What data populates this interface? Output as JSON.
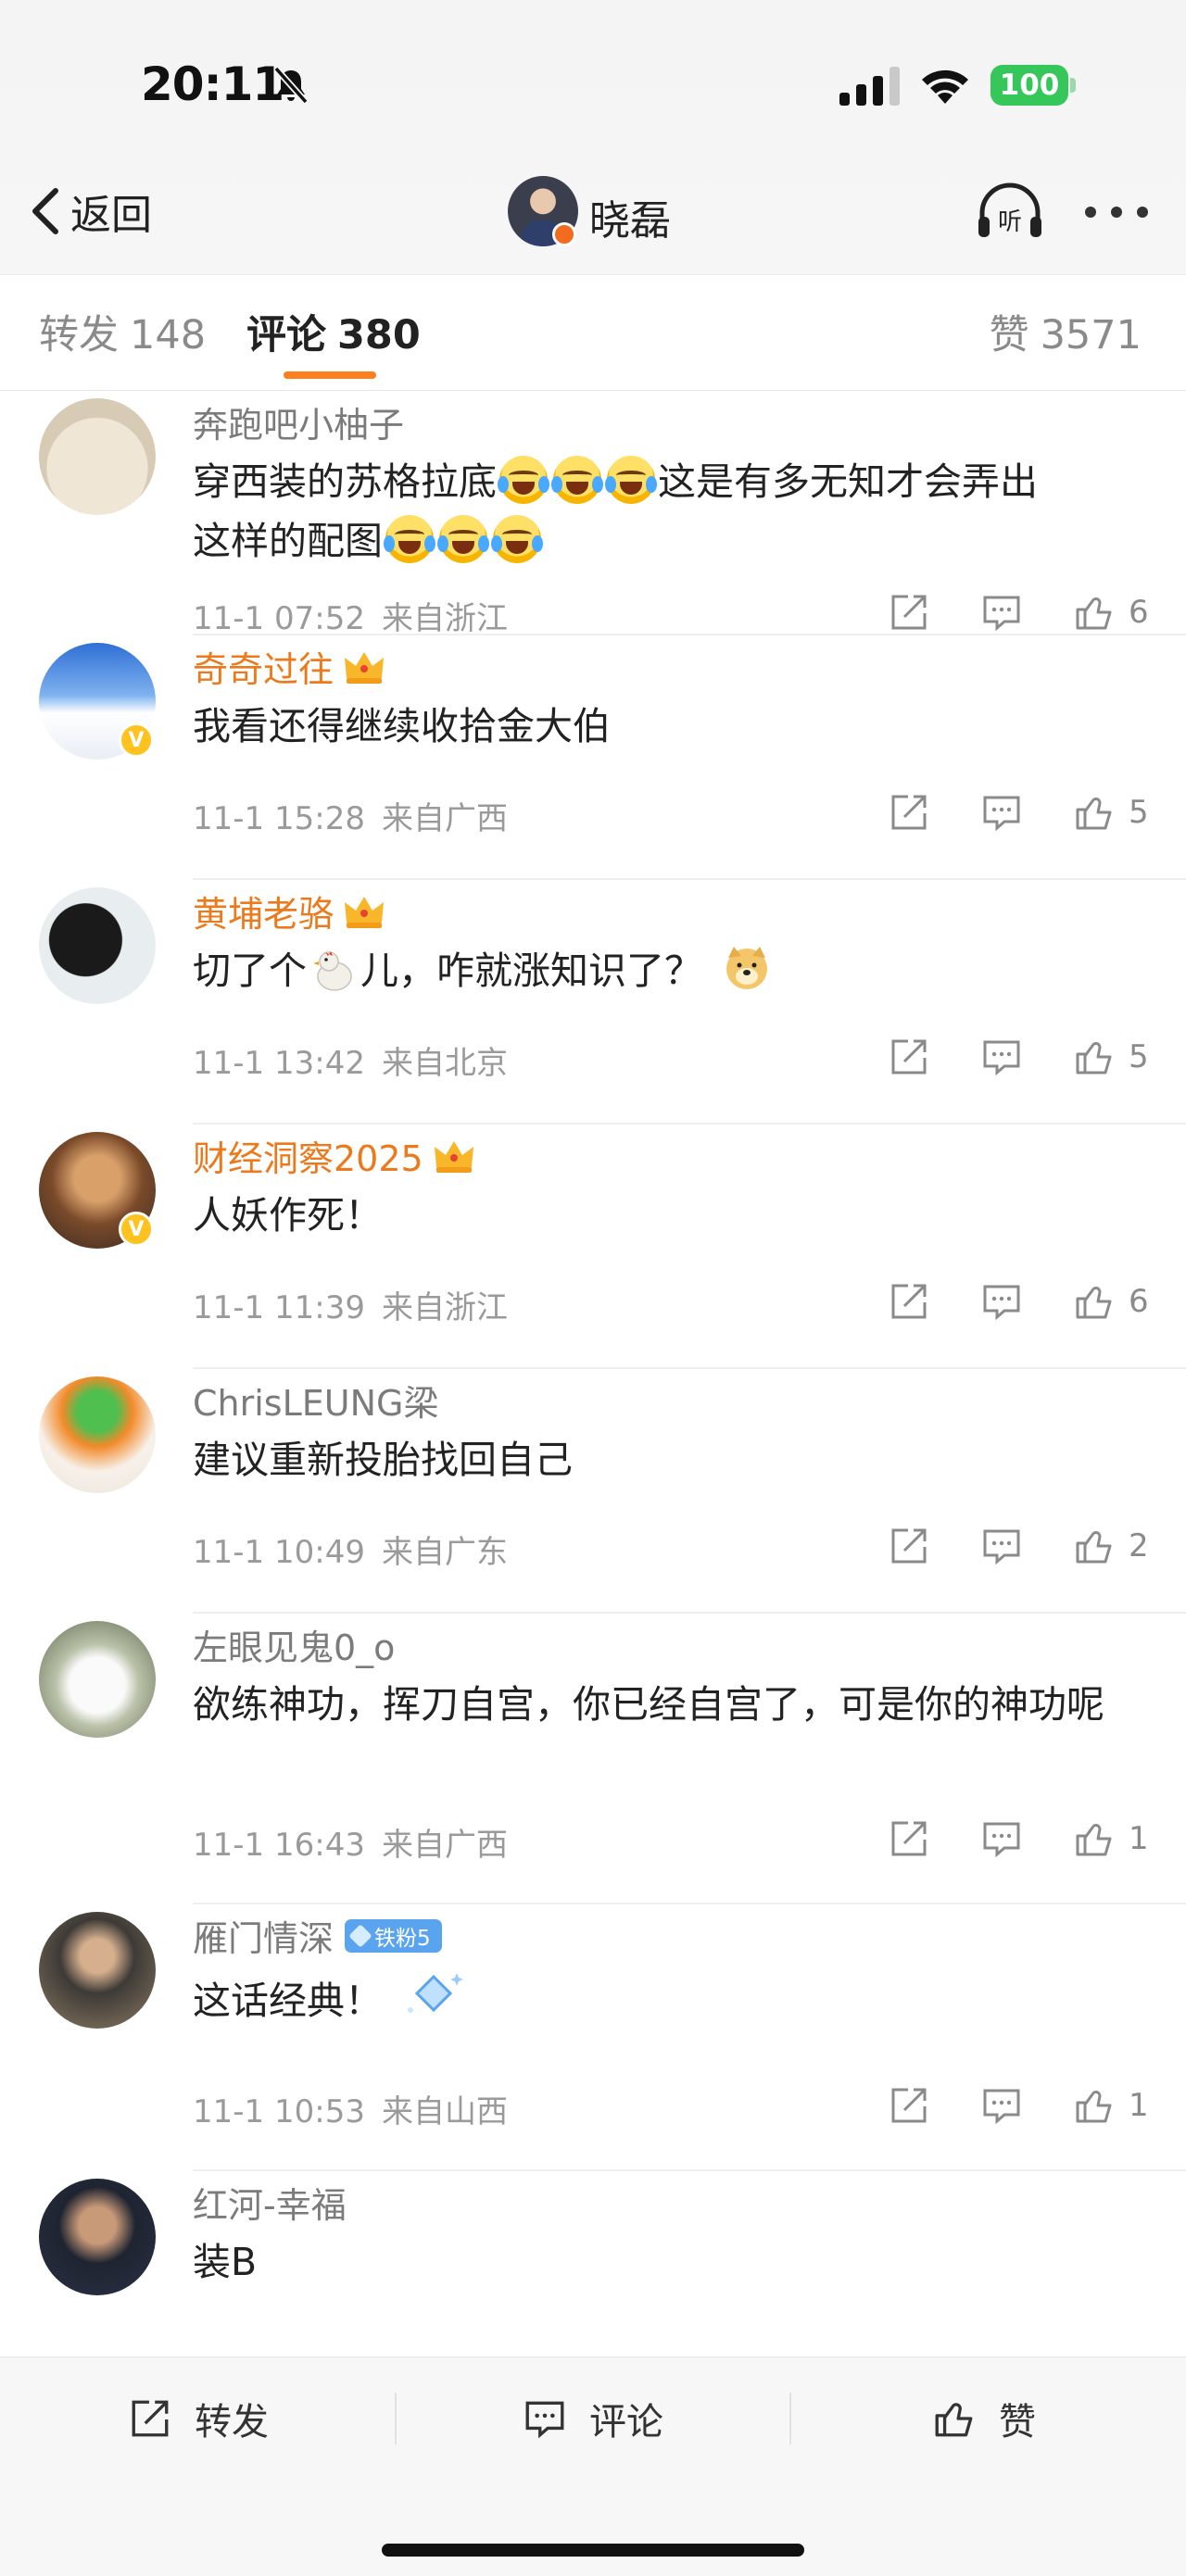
{
  "status": {
    "time": "20:11",
    "battery": "100"
  },
  "header": {
    "back_label": "返回",
    "user_name": "晓磊"
  },
  "tabs": {
    "repost": {
      "label": "转发",
      "count": "148"
    },
    "comment": {
      "label": "评论",
      "count": "380"
    },
    "like": {
      "label": "赞",
      "count": "3571"
    }
  },
  "comments": [
    {
      "name": "奔跑吧小柚子",
      "text_a": "穿西装的苏格拉底",
      "text_b": "这是有多无知才会弄出",
      "text_c": "这样的配图",
      "time": "11-1 07:52",
      "location": "来自浙江",
      "likes": "6"
    },
    {
      "name": "奇奇过往",
      "text": "我看还得继续收拾金大伯",
      "time": "11-1 15:28",
      "location": "来自广西",
      "likes": "5"
    },
    {
      "name": "黄埔老骆",
      "text_a": "切了个",
      "text_b": "儿，咋就涨知识了？",
      "time": "11-1 13:42",
      "location": "来自北京",
      "likes": "5"
    },
    {
      "name": "财经洞察2025",
      "text": "人妖作死！",
      "time": "11-1 11:39",
      "location": "来自浙江",
      "likes": "6"
    },
    {
      "name": "ChrisLEUNG梁",
      "text": "建议重新投胎找回自己",
      "time": "11-1 10:49",
      "location": "来自广东",
      "likes": "2"
    },
    {
      "name": "左眼见鬼0_o",
      "text": "欲练神功，挥刀自宫，你已经自宫了，可是你的神功呢",
      "time": "11-1 16:43",
      "location": "来自广西",
      "likes": "1"
    },
    {
      "name": "雁门情深",
      "badge": "铁粉5",
      "text": "这话经典！",
      "time": "11-1 10:53",
      "location": "来自山西",
      "likes": "1"
    },
    {
      "name": "红河-幸福",
      "text": "装B"
    }
  ],
  "bottom_bar": {
    "repost": "转发",
    "comment": "评论",
    "like": "赞"
  },
  "colors": {
    "accent": "#ff7e1e",
    "vip_name": "#ec7a1c",
    "verified_badge": "#ffc21f",
    "fan_badge": "#5aa4ef",
    "battery": "#35c759"
  },
  "icons": [
    "bell-slash-icon",
    "signal-icon",
    "wifi-icon",
    "battery-icon",
    "back-chevron-icon",
    "listen-icon",
    "more-icon",
    "share-icon",
    "comment-icon",
    "thumbs-up-icon",
    "crown-icon"
  ]
}
